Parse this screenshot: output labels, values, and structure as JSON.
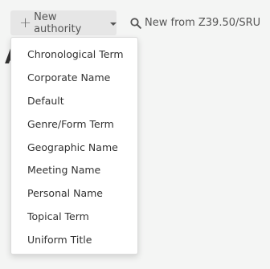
{
  "toolbar": {
    "new_authority_label": "New authority",
    "z3950_label": "New from Z39.50/SRU"
  },
  "heading_peek": "A",
  "dropdown": {
    "items": [
      {
        "label": "Chronological Term"
      },
      {
        "label": "Corporate Name"
      },
      {
        "label": "Default"
      },
      {
        "label": "Genre/Form Term"
      },
      {
        "label": "Geographic Name"
      },
      {
        "label": "Meeting Name"
      },
      {
        "label": "Personal Name"
      },
      {
        "label": "Topical Term"
      },
      {
        "label": "Uniform Title"
      }
    ]
  },
  "icons": {
    "plus": "plus-icon",
    "caret": "caret-down-icon",
    "search": "search-icon"
  },
  "colors": {
    "page_background": "#f4f5f4",
    "button_background": "#e6e6e6",
    "menu_background": "#ffffff",
    "text": "#333333"
  }
}
